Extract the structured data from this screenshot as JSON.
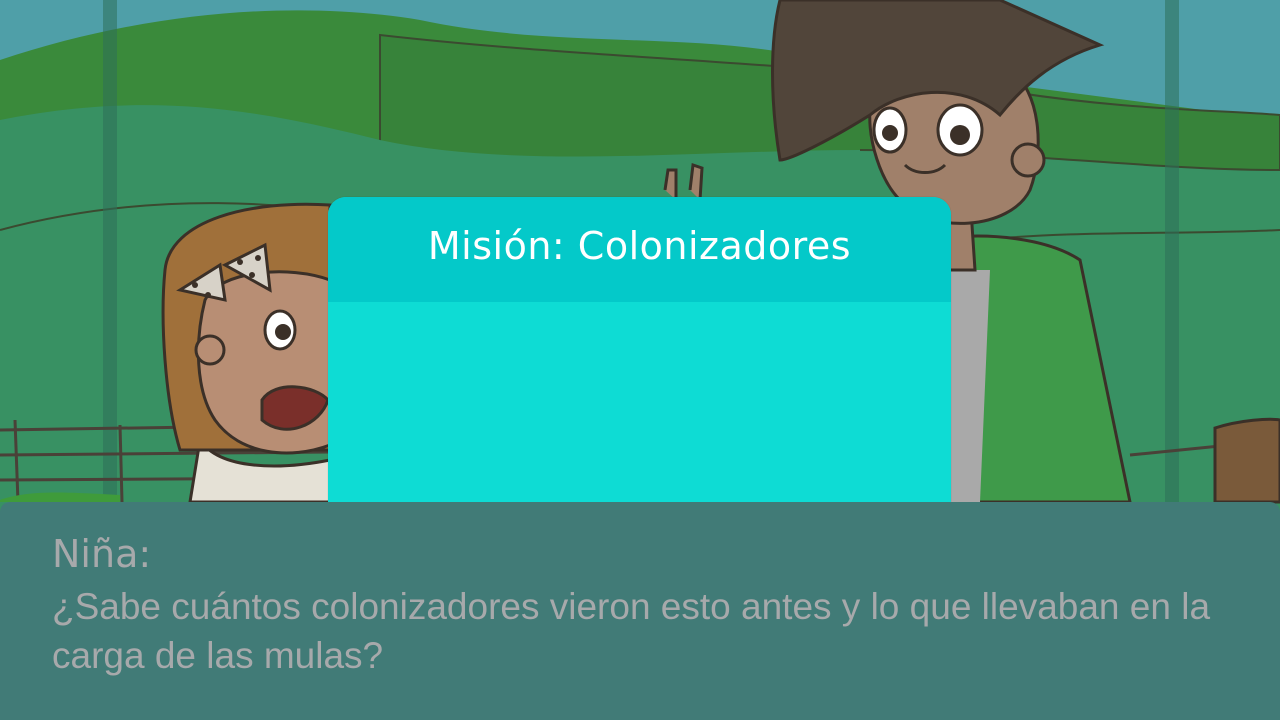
{
  "mission": {
    "title": "Misión: Colonizadores"
  },
  "dialog": {
    "speaker": "Niña:",
    "text": "¿Sabe cuántos colonizadores vieron esto antes y lo que llevaban en la carga de las mulas?"
  },
  "colors": {
    "sky": "#4f9fa8",
    "hills": "#2f8a4a",
    "panel_header": "#04c9c9",
    "panel_body": "#0edcd4",
    "dialog_bg": "#417b77",
    "dialog_text": "#a7a9ab"
  }
}
